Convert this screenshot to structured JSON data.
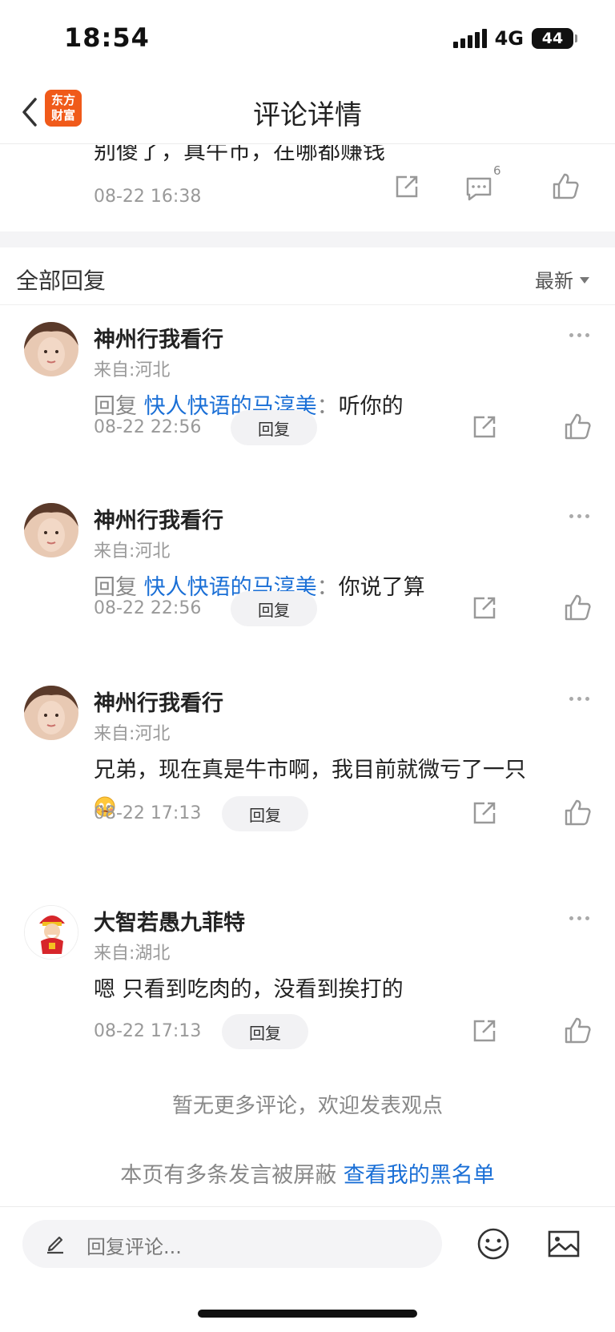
{
  "status_bar": {
    "time": "18:54",
    "network": "4G",
    "battery": "44"
  },
  "nav": {
    "title": "评论详情",
    "logo_line1": "东方",
    "logo_line2": "财富"
  },
  "original_comment": {
    "text": "别傻了，真牛市，在哪都赚钱",
    "time": "08-22 16:38",
    "reply_count": "6"
  },
  "section": {
    "title": "全部回复",
    "sort_label": "最新"
  },
  "replies": [
    {
      "name": "神州行我看行",
      "location": "来自:河北",
      "prefix": "回复",
      "target": "快人快语的马淳美",
      "colon": "：",
      "text": "听你的",
      "time": "08-22 22:56",
      "reply_label": "回复"
    },
    {
      "name": "神州行我看行",
      "location": "来自:河北",
      "prefix": "回复",
      "target": "快人快语的马淳美",
      "colon": "：",
      "text": "你说了算",
      "time": "08-22 22:56",
      "reply_label": "回复"
    },
    {
      "name": "神州行我看行",
      "location": "来自:河北",
      "text": "兄弟，现在真是牛市啊，我目前就微亏了一只",
      "time": "08-22 17:13",
      "reply_label": "回复"
    },
    {
      "name": "大智若愚九菲特",
      "location": "来自:湖北",
      "text": "嗯 只看到吃肉的，没看到挨打的",
      "time": "08-22 17:13",
      "reply_label": "回复"
    }
  ],
  "footer": {
    "no_more": "暂无更多评论，欢迎发表观点",
    "blocked_text": "本页有多条发言被屏蔽",
    "blocked_link": "查看我的黑名单"
  },
  "bottom_bar": {
    "placeholder": "回复评论..."
  }
}
